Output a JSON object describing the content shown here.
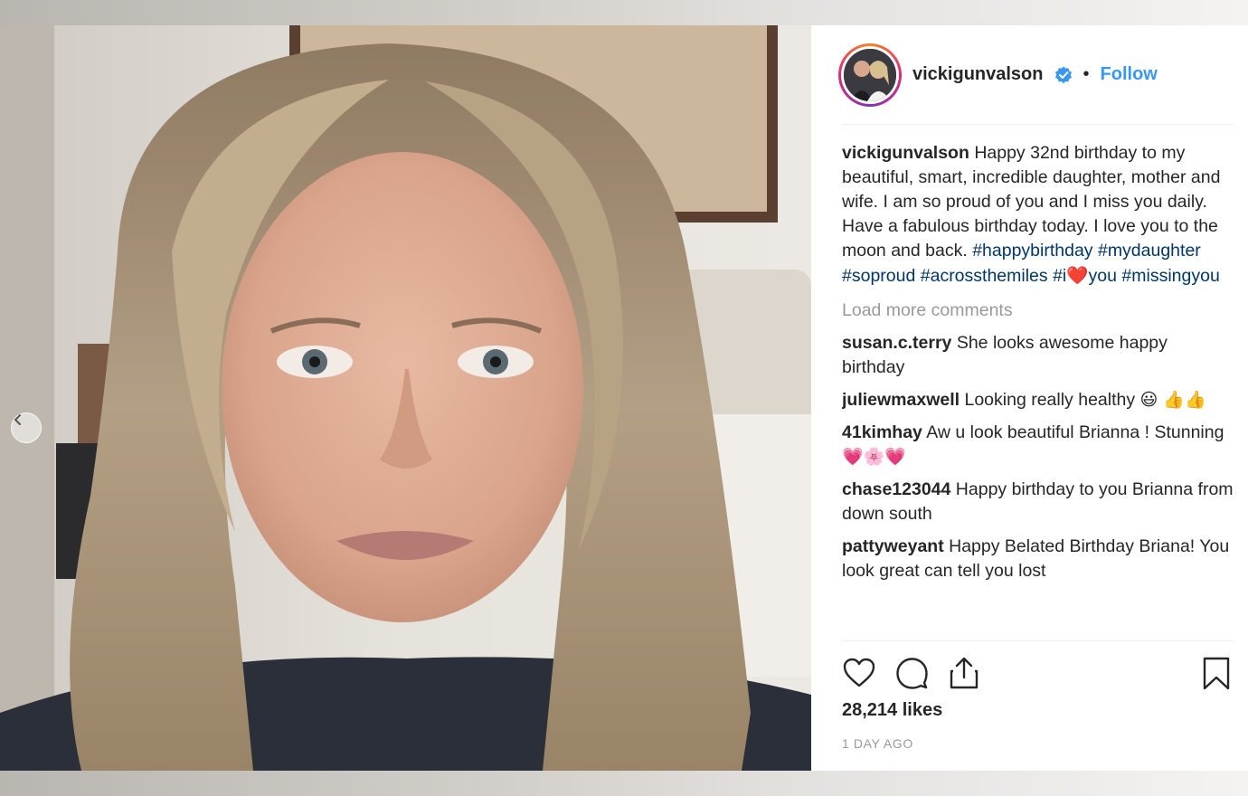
{
  "post": {
    "author": "vickigunvalson",
    "follow_label": "Follow",
    "separator": "•",
    "caption": {
      "author": "vickigunvalson",
      "text": "Happy 32nd birthday to my beautiful, smart, incredible daughter, mother and wife. I am so proud of you and I miss you daily. Have a fabulous birthday today. I love you to the moon and back.",
      "hashtags_line1": [
        "#happybirthday",
        "#mydaughter",
        "#soproud"
      ],
      "hashtags_line2_a": "#acrossthemiles",
      "hashtags_line2_b": "#i",
      "heart_emoji": "❤️",
      "hashtags_line2_c": "you",
      "hashtags_line2_d": "#missingyou"
    },
    "load_more_label": "Load more comments",
    "comments": [
      {
        "user": "susan.c.terry",
        "text": "She looks awesome happy birthday"
      },
      {
        "user": "juliewmaxwell",
        "text": "Looking really healthy",
        "emoji": "😃 👍👍"
      },
      {
        "user": "41kimhay",
        "text": "Aw u look beautiful Brianna ! Stunning",
        "emoji": "💗🌸💗"
      },
      {
        "user": "chase123044",
        "text": "Happy birthday to you Brianna from down south"
      },
      {
        "user": "pattyweyant",
        "text": "Happy Belated Birthday Briana! You look great can tell you lost"
      }
    ],
    "likes": "28,214 likes",
    "timestamp": "1 DAY AGO"
  },
  "icons": {
    "like": "heart-outline-icon",
    "comment": "speech-bubble-icon",
    "share": "share-upload-icon",
    "save": "bookmark-icon",
    "prev": "chevron-left-icon",
    "verified": "verified-badge-icon"
  },
  "colors": {
    "link_blue": "#3897f0",
    "hashtag": "#003569",
    "muted": "#999999",
    "text": "#262626"
  }
}
